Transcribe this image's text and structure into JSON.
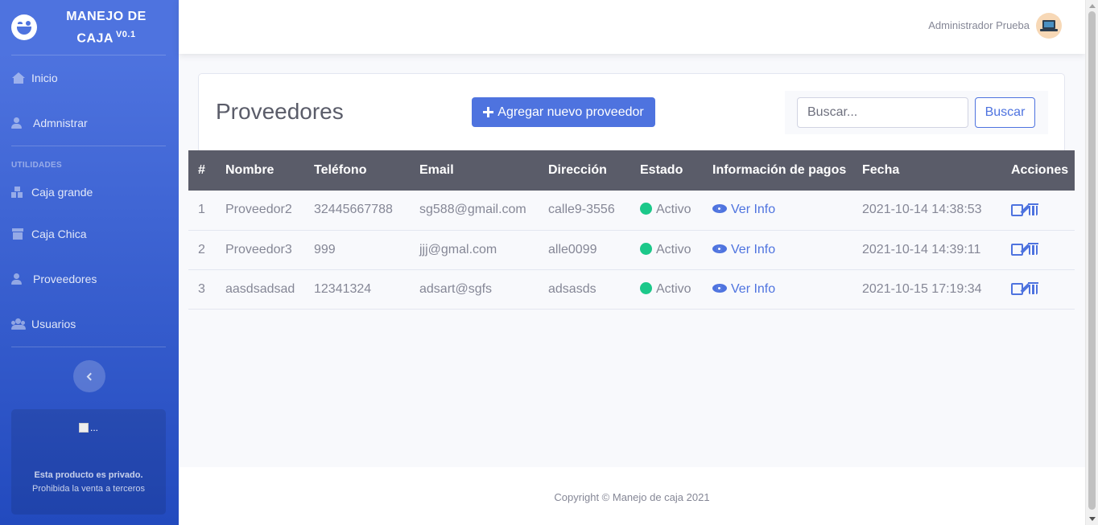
{
  "brand": {
    "title": "MANEJO DE CAJA",
    "version": "V0.1"
  },
  "sidebar": {
    "items": [
      {
        "label": "Inicio",
        "icon": "home-icon"
      },
      {
        "label": "Admnistrar",
        "icon": "user-cog-icon"
      }
    ],
    "heading": "UTILIDADES",
    "utility_items": [
      {
        "label": "Caja grande",
        "icon": "boxes-icon"
      },
      {
        "label": "Caja Chica",
        "icon": "box-icon"
      },
      {
        "label": "Proveedores",
        "icon": "user-tie-icon"
      },
      {
        "label": "Usuarios",
        "icon": "users-icon"
      }
    ],
    "promo": {
      "image_alt": "...",
      "title": "Esta producto es privado.",
      "subtitle": "Prohibida la venta a terceros"
    }
  },
  "topbar": {
    "user_name": "Administrador Prueba"
  },
  "page": {
    "title": "Proveedores",
    "add_button": "Agregar nuevo proveedor",
    "search": {
      "placeholder": "Buscar...",
      "button": "Buscar"
    }
  },
  "table": {
    "headers": [
      "#",
      "Nombre",
      "Teléfono",
      "Email",
      "Dirección",
      "Estado",
      "Información de pagos",
      "Fecha",
      "Acciones"
    ],
    "rows": [
      {
        "n": "1",
        "nombre": "Proveedor2",
        "telefono": "32445667788",
        "email": "sg588@gmail.com",
        "direccion": "calle9-3556",
        "estado": "Activo",
        "info": "Ver Info",
        "fecha": "2021-10-14 14:38:53"
      },
      {
        "n": "2",
        "nombre": "Proveedor3",
        "telefono": "999",
        "email": "jjj@gmal.com",
        "direccion": "alle0099",
        "estado": "Activo",
        "info": "Ver Info",
        "fecha": "2021-10-14 14:39:11"
      },
      {
        "n": "3",
        "nombre": "aasdsadsad",
        "telefono": "12341324",
        "email": "adsart@sgfs",
        "direccion": "adsasds",
        "estado": "Activo",
        "info": "Ver Info",
        "fecha": "2021-10-15 17:19:34"
      }
    ]
  },
  "footer": {
    "text": "Copyright © Manejo de caja 2021"
  },
  "colors": {
    "primary": "#4e73df",
    "success": "#1cc88a",
    "dark": "#5a5c69",
    "muted": "#858796"
  }
}
